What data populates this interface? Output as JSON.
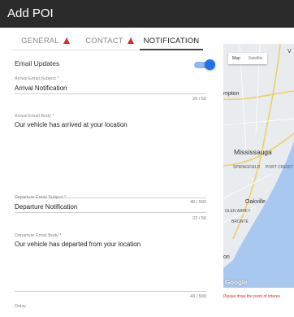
{
  "window": {
    "title": "Add POI"
  },
  "tabs": [
    {
      "label": "GENERAL",
      "warning": true,
      "active": false
    },
    {
      "label": "CONTACT",
      "warning": true,
      "active": false
    },
    {
      "label": "NOTIFICATION",
      "warning": false,
      "active": true
    }
  ],
  "email_updates": {
    "label": "Email Updates",
    "enabled": true
  },
  "fields": {
    "arrival_subject": {
      "label": "Arrival Email Subject *",
      "value": "Arrival Notification",
      "counter": "20 / 50"
    },
    "arrival_body": {
      "label": "Arrival Email Body *",
      "value": "Our vehicle has arrived at your location",
      "counter": "40 / 500"
    },
    "departure_subject": {
      "label": "Departure Email Subject *",
      "value": "Departure Notification",
      "counter": "22 / 50"
    },
    "departure_body": {
      "label": "Departure Email Body *",
      "value": "Our vehicle has departed from your location",
      "counter": "43 / 500"
    },
    "delay": {
      "label": "Delay"
    }
  },
  "map": {
    "tabs": [
      "Map",
      "Satellite"
    ],
    "places": {
      "v": "V",
      "mpton": "mpton",
      "mississauga": "Mississauga",
      "oakville": "Oakville",
      "on": "on",
      "springfield": "SPRINGFIELD",
      "port_credit": "PORT CREDIT",
      "glen_abbey": "GLEN ABBEY",
      "bronte": "BRONTE"
    },
    "logo": "Google",
    "colors": {
      "water": "#a9c8f0",
      "land": "#e8ecef",
      "highway": "#f2cd6b",
      "road": "#ffffff"
    },
    "error": "Please draw the point of interes"
  },
  "colors": {
    "titlebar": "#2b2b2b",
    "accent": "#1e73e8",
    "warning": "#d32f2f"
  }
}
